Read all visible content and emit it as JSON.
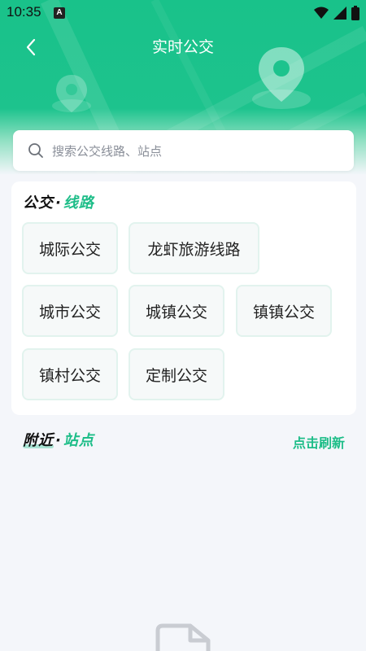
{
  "status_bar": {
    "time": "10:35",
    "notification_badge": "A",
    "icons": [
      "wifi-icon",
      "signal-icon",
      "battery-icon"
    ]
  },
  "nav": {
    "back_icon": "chevron-left-icon",
    "title": "实时公交"
  },
  "search": {
    "icon": "search-icon",
    "placeholder": "搜索公交线路、站点"
  },
  "routes_section": {
    "title_part1": "公交",
    "separator": "·",
    "title_part2": "线路",
    "chips": [
      {
        "label": "城际公交"
      },
      {
        "label": "龙虾旅游线路"
      },
      {
        "label": "城市公交"
      },
      {
        "label": "城镇公交"
      },
      {
        "label": "镇镇公交"
      },
      {
        "label": "镇村公交"
      },
      {
        "label": "定制公交"
      }
    ]
  },
  "nearby_section": {
    "title_part1": "附近",
    "separator": "·",
    "title_part2": "站点",
    "refresh_label": "点击刷新"
  },
  "colors": {
    "brand_green": "#1dc38d",
    "accent_text": "#1dbd88",
    "page_bg": "#f4f6fa"
  }
}
